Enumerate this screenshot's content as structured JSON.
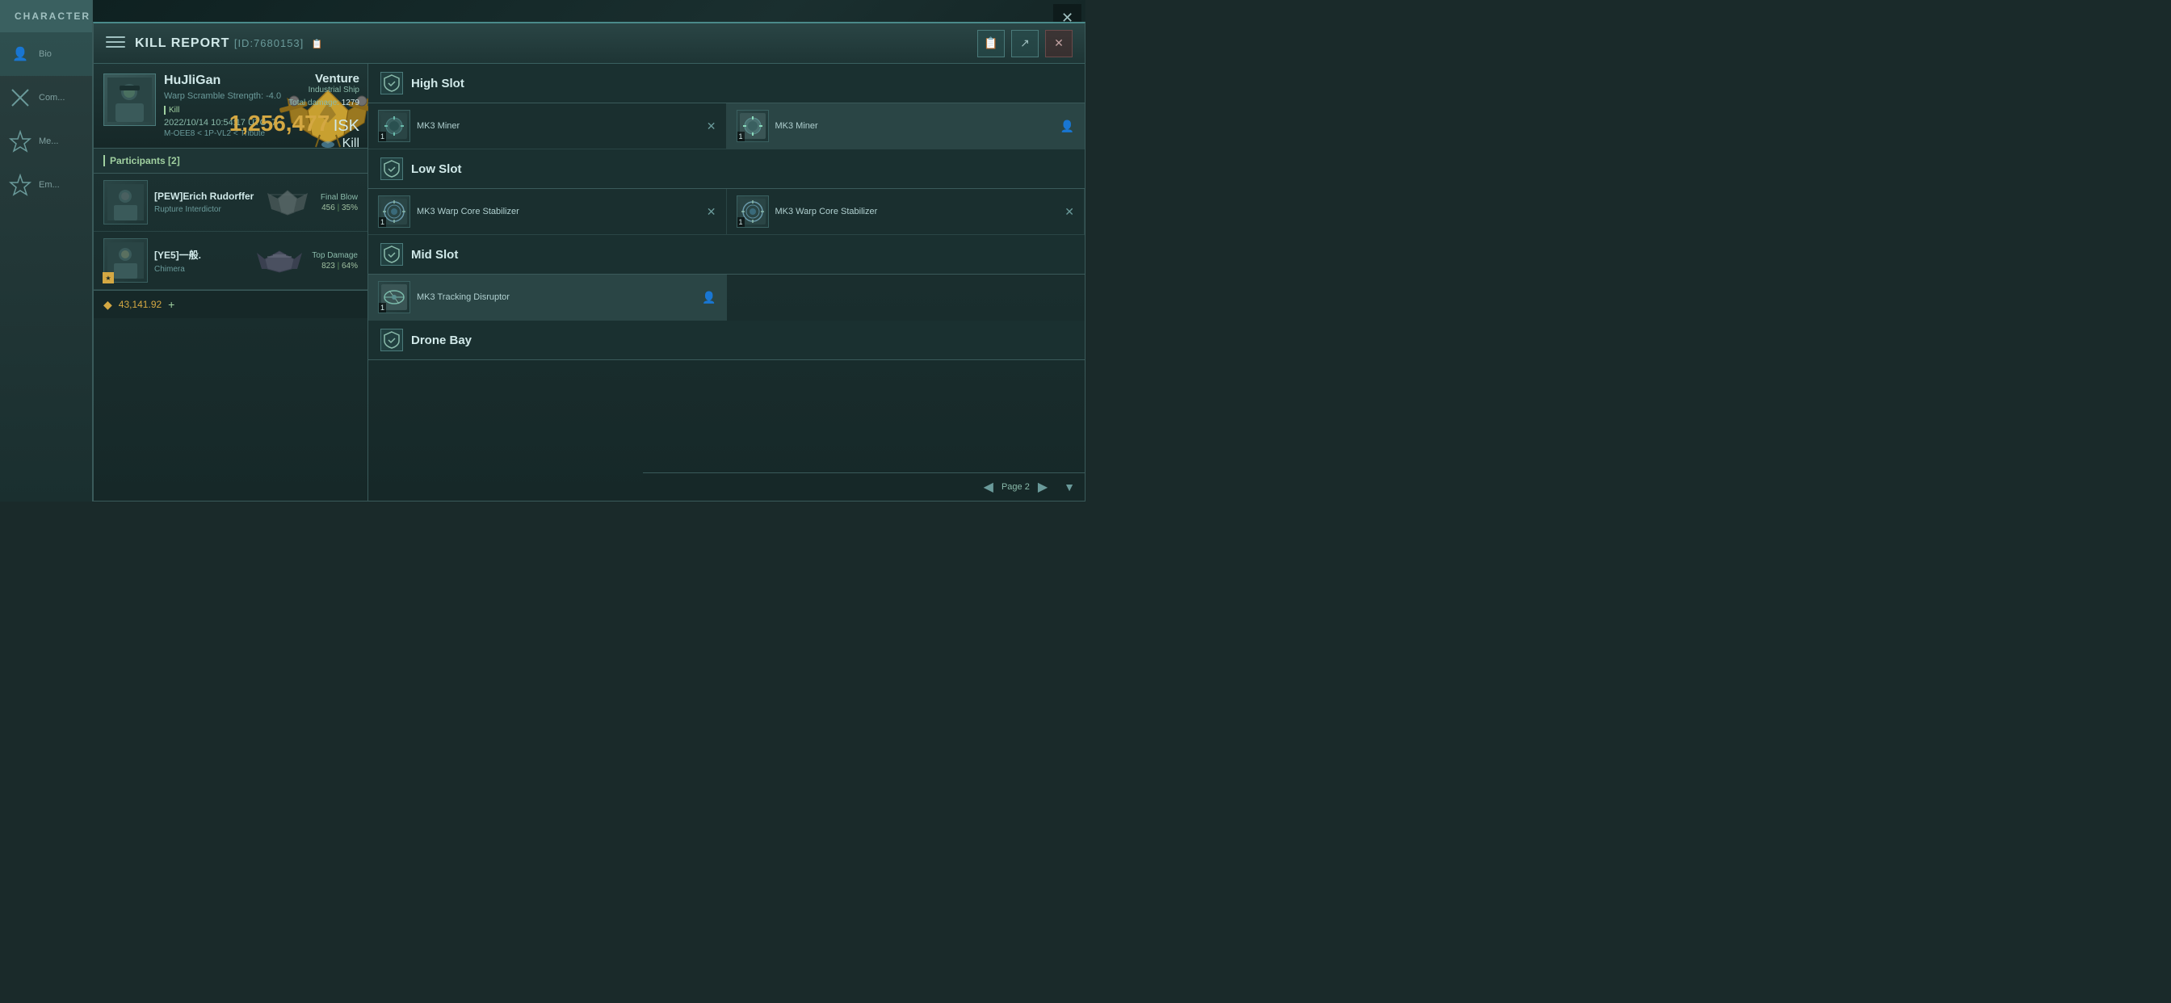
{
  "app": {
    "title": "CHARACTER",
    "close_label": "✕"
  },
  "character_nav": {
    "items": [
      {
        "id": "bio",
        "label": "Bio",
        "icon": "👤"
      },
      {
        "id": "combat",
        "label": "Com...",
        "icon": "⚔"
      },
      {
        "id": "medals",
        "label": "Me...",
        "icon": "★"
      },
      {
        "id": "employment",
        "label": "Em...",
        "icon": "★"
      }
    ]
  },
  "kill_report": {
    "header": {
      "title": "KILL REPORT",
      "id": "[ID:7680153]",
      "copy_icon": "📋",
      "export_icon": "↗",
      "close_icon": "✕"
    },
    "victim": {
      "name": "HuJliGan",
      "warp_scramble": "Warp Scramble Strength: -4.0",
      "kill_label": "Kill",
      "datetime": "2022/10/14 10:54:17 UTC -7",
      "location": "M-OEE8 < 1P-VL2 < Tribute"
    },
    "ship": {
      "class": "Venture",
      "type": "Industrial Ship",
      "total_damage_label": "Total damage:",
      "total_damage_value": "1279",
      "isk_value": "1,256,477",
      "isk_currency": "ISK",
      "kill_type": "Kill"
    },
    "participants": {
      "title": "Participants [2]",
      "items": [
        {
          "name": "[PEW]Erich Rudorffer",
          "ship": "Rupture Interdictor",
          "stat_label": "Final Blow",
          "damage": "456",
          "percent": "35%"
        },
        {
          "name": "[YE5]一般.",
          "ship": "Chimera",
          "stat_label": "Top Damage",
          "damage": "823",
          "percent": "64%"
        }
      ]
    },
    "bottom_isk": "43,141.92",
    "navigation": {
      "page_label": "Page 2",
      "prev_arrow": "◀",
      "next_arrow": "▶"
    }
  },
  "fitting": {
    "slots": [
      {
        "id": "high-slot",
        "title": "High Slot",
        "items": [
          {
            "name": "MK3 Miner",
            "qty": "1",
            "action_type": "close",
            "active": false
          },
          {
            "name": "MK3 Miner",
            "qty": "1",
            "action_type": "person",
            "active": true
          }
        ]
      },
      {
        "id": "low-slot",
        "title": "Low Slot",
        "items": [
          {
            "name": "MK3 Warp Core Stabilizer",
            "qty": "1",
            "action_type": "close",
            "active": false
          },
          {
            "name": "MK3 Warp Core Stabilizer",
            "qty": "1",
            "action_type": "close",
            "active": false
          }
        ]
      },
      {
        "id": "mid-slot",
        "title": "Mid Slot",
        "items": [
          {
            "name": "MK3 Tracking Disruptor",
            "qty": "1",
            "action_type": "person",
            "active": true
          }
        ]
      },
      {
        "id": "drone-bay",
        "title": "Drone Bay",
        "items": []
      }
    ]
  }
}
